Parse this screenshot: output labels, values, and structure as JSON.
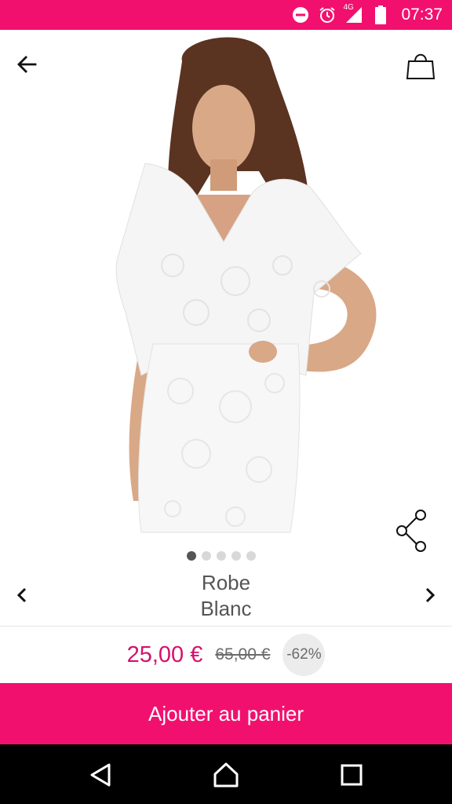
{
  "status_bar": {
    "time": "07:37",
    "network_label": "4G",
    "icons": [
      "do-not-disturb-icon",
      "alarm-icon",
      "signal-icon",
      "battery-icon"
    ],
    "background": "#f2106f"
  },
  "header": {
    "back_icon": "arrow-back-icon",
    "bag_icon": "shopping-bag-icon"
  },
  "gallery": {
    "image_description_icon": "product-photo",
    "dots_count": 5,
    "active_dot_index": 0,
    "share_icon": "share-icon"
  },
  "product": {
    "name": "Robe",
    "color": "Blanc",
    "prev_icon": "chevron-left-icon",
    "next_icon": "chevron-right-icon"
  },
  "pricing": {
    "current_price": "25,00 €",
    "old_price": "65,00 €",
    "discount": "-62%",
    "accent_color": "#d4116e"
  },
  "actions": {
    "add_to_cart_label": "Ajouter au panier",
    "button_color": "#f2106f"
  },
  "nav_bar": {
    "icons": [
      "nav-back-icon",
      "nav-home-icon",
      "nav-recents-icon"
    ]
  }
}
